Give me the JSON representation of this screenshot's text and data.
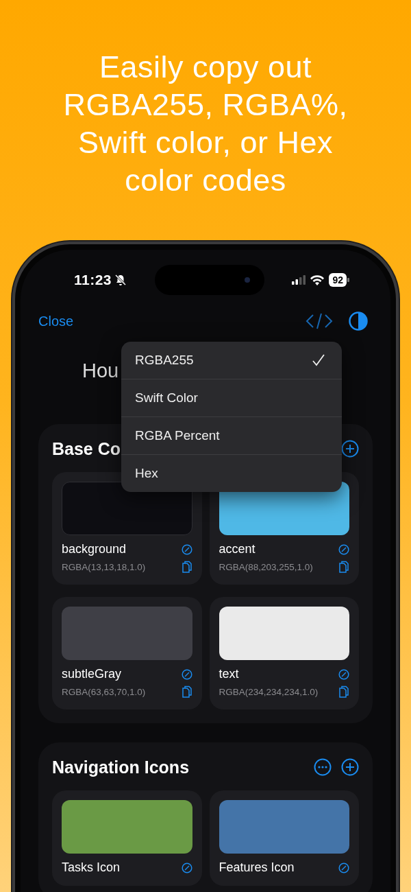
{
  "headline": [
    "Easily copy out",
    "RGBA255, RGBA%,",
    "Swift color, or Hex",
    "color codes"
  ],
  "status_bar": {
    "time": "11:23",
    "battery": "92"
  },
  "nav": {
    "close": "Close"
  },
  "title": "Hou",
  "format_menu": [
    {
      "label": "RGBA255",
      "selected": true
    },
    {
      "label": "Swift Color",
      "selected": false
    },
    {
      "label": "RGBA Percent",
      "selected": false
    },
    {
      "label": "Hex",
      "selected": false
    }
  ],
  "sections": [
    {
      "title": "Base Co",
      "colors": [
        {
          "name": "background",
          "value": "RGBA(13,13,18,1.0)",
          "color": "#0d0d12"
        },
        {
          "name": "accent",
          "value": "RGBA(88,203,255,1.0)",
          "color": "#4fb8e6"
        },
        {
          "name": "subtleGray",
          "value": "RGBA(63,63,70,1.0)",
          "color": "#3f3f46"
        },
        {
          "name": "text",
          "value": "RGBA(234,234,234,1.0)",
          "color": "#eaeaea"
        }
      ]
    },
    {
      "title": "Navigation Icons",
      "colors": [
        {
          "name": "Tasks Icon",
          "color": "#6a9a45"
        },
        {
          "name": "Features Icon",
          "color": "#4474a8"
        }
      ]
    }
  ]
}
